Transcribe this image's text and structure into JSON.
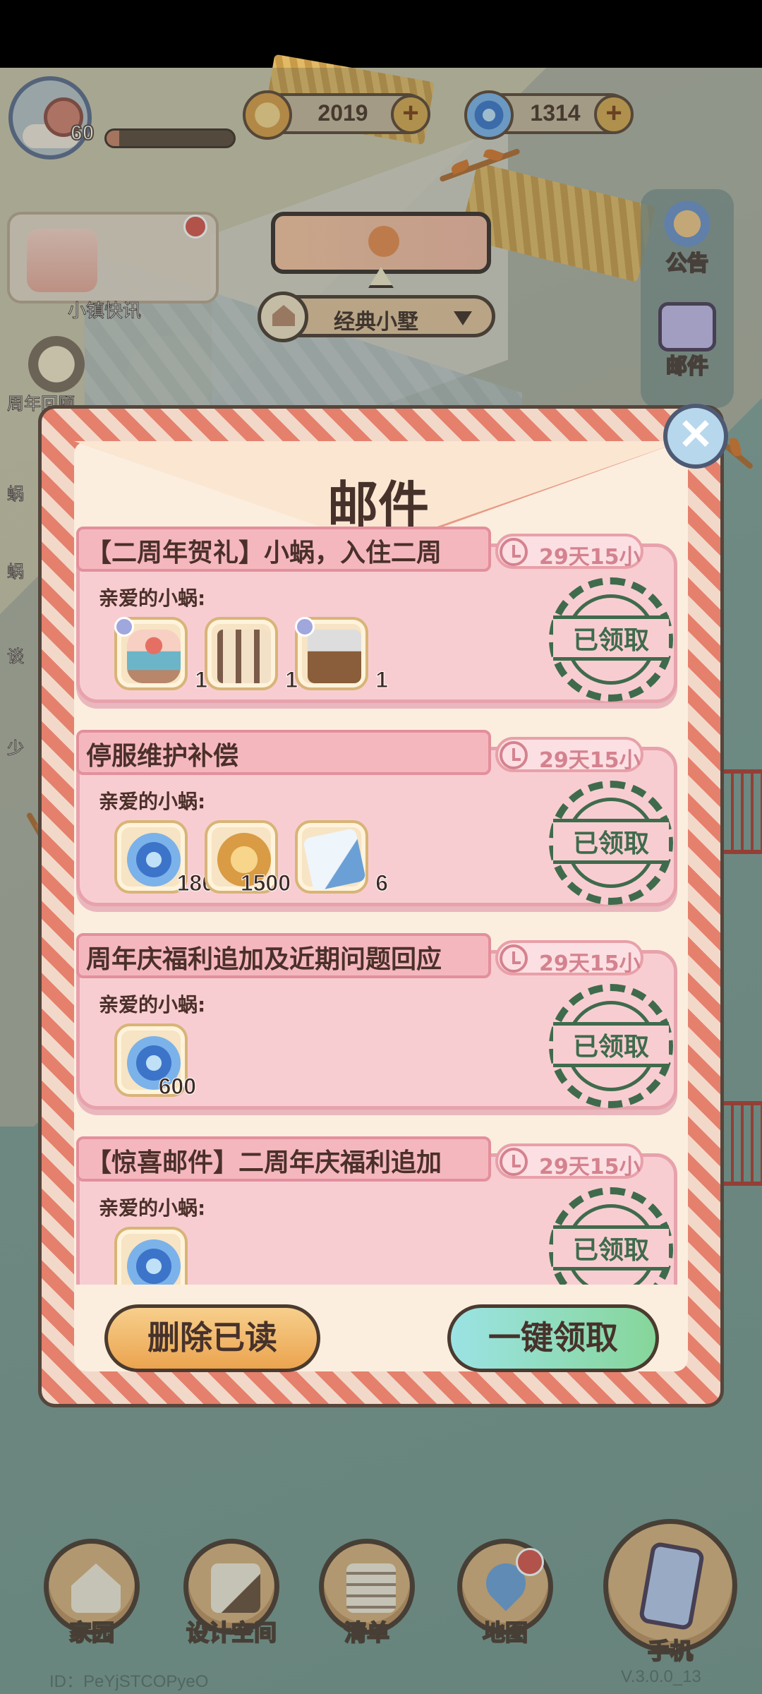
{
  "topbar": {
    "level": "60",
    "xp_progress": 0.1,
    "coins": "2019",
    "gems": "1314",
    "plus": "+"
  },
  "side_buttons": [
    {
      "label": "公告",
      "icon": "megaphone-icon"
    },
    {
      "label": "邮件",
      "icon": "envelope-icon"
    }
  ],
  "left_widgets": {
    "town_news": "小镇快讯",
    "anniversary": "周年回顾",
    "item3": "蜗",
    "item4": "蜗",
    "item5": "谈",
    "item6": "少"
  },
  "home": {
    "name": "经典小墅"
  },
  "mail": {
    "title": "邮件",
    "close": "✕",
    "items": [
      {
        "title": "【二周年贺礼】小蜗，入住二周",
        "timer": "29天15小",
        "greeting": "亲爱的小蜗:",
        "status": "已领取",
        "rewards": [
          {
            "icon": "cake-icon",
            "count": "1"
          },
          {
            "icon": "photo-frames-icon",
            "count": "1"
          },
          {
            "icon": "gift-box-icon",
            "count": "1"
          }
        ]
      },
      {
        "title": "停服维护补偿",
        "timer": "29天15小",
        "greeting": "亲爱的小蜗:",
        "status": "已领取",
        "rewards": [
          {
            "icon": "gem-icon",
            "count": "180"
          },
          {
            "icon": "coin-icon",
            "count": "1500"
          },
          {
            "icon": "ticket-icon",
            "count": "6"
          }
        ]
      },
      {
        "title": "周年庆福利追加及近期问题回应",
        "timer": "29天15小",
        "greeting": "亲爱的小蜗:",
        "status": "已领取",
        "rewards": [
          {
            "icon": "gem-icon",
            "count": "600"
          }
        ]
      },
      {
        "title": "【惊喜邮件】二周年庆福利追加",
        "timer": "29天15小",
        "greeting": "亲爱的小蜗:",
        "status": "已领取",
        "rewards": [
          {
            "icon": "gem-icon",
            "count": ""
          }
        ]
      }
    ],
    "delete_read": "删除已读",
    "claim_all": "一键领取"
  },
  "bottom_nav": [
    {
      "label": "家园",
      "icon": "home-icon"
    },
    {
      "label": "设计空间",
      "icon": "design-tools-icon"
    },
    {
      "label": "清单",
      "icon": "list-icon"
    },
    {
      "label": "地图",
      "icon": "map-pin-icon"
    },
    {
      "label": "手机",
      "icon": "phone-icon"
    }
  ],
  "footer": {
    "player_id": "ID：PeYjSTCOPyeO",
    "version": "V.3.0.0_13"
  }
}
